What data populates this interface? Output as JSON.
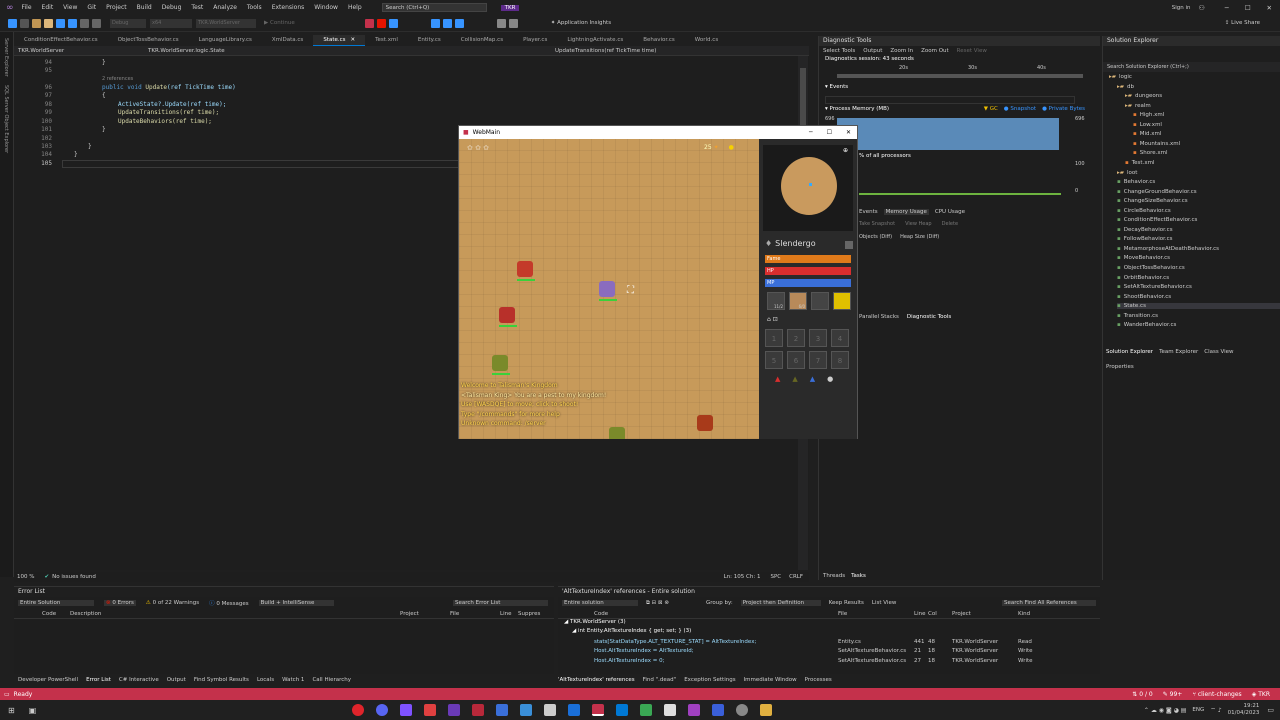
{
  "menu": {
    "items": [
      "File",
      "Edit",
      "View",
      "Git",
      "Project",
      "Build",
      "Debug",
      "Test",
      "Analyze",
      "Tools",
      "Extensions",
      "Window",
      "Help"
    ],
    "search": "Search (Ctrl+Q)",
    "app_badge": "TKR",
    "sign_in": "Sign in",
    "live_share": "Live Share"
  },
  "toolbar": {
    "config": "Debug",
    "platform": "x64",
    "target": "TKR.WorldServer",
    "continue": "Continue",
    "insights": "Application Insights"
  },
  "left_strip": [
    "Server Explorer",
    "SQL Server Object Explorer"
  ],
  "tabs": [
    "ConditionEffectBehavior.cs",
    "ObjectTossBehavior.cs",
    "LanguageLibrary.cs",
    "XmlData.cs",
    "State.cs",
    "Test.xml",
    "Entity.cs",
    "CollisionMap.cs",
    "Player.cs",
    "LightningActivate.cs",
    "Behavior.cs",
    "World.cs"
  ],
  "active_tab": "State.cs",
  "navbar": {
    "project": "TKR.WorldServer",
    "class": "TKR.WorldServer.logic.State",
    "member": "UpdateTransitions(ref TickTime time)"
  },
  "editor": {
    "line_numbers": [
      "94",
      "",
      "95",
      "96",
      "97",
      "98",
      "99",
      "100",
      "101",
      "102",
      "103",
      "104",
      "105"
    ],
    "refs": "2 references",
    "lines": {
      "l94": "}",
      "l96_kw": "public void ",
      "l96_fn": "Update",
      "l96_rest": "(ref TickTime time)",
      "l97": "{",
      "l98": "ActiveState?.Update(ref time);",
      "l99": "UpdateTransitions(ref time);",
      "l100": "UpdateBehaviors(ref time);",
      "l101": "}",
      "l102": "}",
      "l103": "}"
    }
  },
  "editor_status": {
    "zoom": "100 %",
    "issues": "No issues found",
    "position": "Ln: 105   Ch: 1",
    "spc": "SPC",
    "crlf": "CRLF"
  },
  "game": {
    "title": "WebMain",
    "player_name": "Slendergo",
    "fame_label": "Fame",
    "hp_label": "HP",
    "mp_label": "MP",
    "slot_counts": [
      "11/2",
      "6/0"
    ],
    "quickslot_nums": [
      "1",
      "2",
      "3",
      "4",
      "5",
      "6",
      "7",
      "8"
    ],
    "chat": [
      {
        "text": "Welcome to Talisman's Kingdom",
        "color": "#ffd34d"
      },
      {
        "text": "<Talisman King> You are a pest to my kingdom!",
        "color": "#ffe9a0"
      },
      {
        "text": "Use [WASDQE] to move; click to shoot!",
        "color": "#ffd34d"
      },
      {
        "text": "Type \"/commands\" for more help",
        "color": "#ffd34d"
      },
      {
        "text": "Unknown command: /server",
        "color": "#ffd34d"
      }
    ],
    "top_counter": "25"
  },
  "diagnostics": {
    "title": "Diagnostic Tools",
    "select_tools": "Select Tools",
    "output": "Output",
    "zoom_in": "Zoom In",
    "zoom_out": "Zoom Out",
    "reset_view": "Reset View",
    "session": "Diagnostics session: 43 seconds",
    "ticks": [
      "20s",
      "30s",
      "40s"
    ],
    "events": "Events",
    "process_memory": "Process Memory (MB)",
    "gc": "GC",
    "snapshot": "Snapshot",
    "private_bytes": "Private Bytes",
    "mem_max": "696",
    "mem_right": "696",
    "cpu_title": "% of all processors",
    "cpu_max": "100",
    "cpu_min": "0",
    "tabs": [
      "Summary",
      "Events",
      "Memory Usage",
      "CPU Usage"
    ],
    "take_snapshot": "Take Snapshot",
    "view_heap": "View Heap",
    "delete": "Delete",
    "objects_diff": "Objects (Diff)",
    "heap_diff": "Heap Size (Diff)",
    "bottom_tabs": [
      "Parallel Stacks",
      "Diagnostic Tools"
    ],
    "threads_tabs": [
      "Threads",
      "Tasks"
    ]
  },
  "solution": {
    "title": "Solution Explorer",
    "search": "Search Solution Explorer (Ctrl+;)",
    "items": [
      {
        "t": "logic",
        "d": 0
      },
      {
        "t": "db",
        "d": 1
      },
      {
        "t": "dungeons",
        "d": 2
      },
      {
        "t": "realm",
        "d": 2
      },
      {
        "t": "High.xml",
        "d": 3
      },
      {
        "t": "Low.xml",
        "d": 3
      },
      {
        "t": "Mid.xml",
        "d": 3
      },
      {
        "t": "Mountains.xml",
        "d": 3
      },
      {
        "t": "Shore.xml",
        "d": 3
      },
      {
        "t": "Test.xml",
        "d": 2
      },
      {
        "t": "loot",
        "d": 1
      },
      {
        "t": "Behavior.cs",
        "d": 1
      },
      {
        "t": "ChangeGroundBehavior.cs",
        "d": 1
      },
      {
        "t": "ChangeSizeBehavior.cs",
        "d": 1
      },
      {
        "t": "CircleBehavior.cs",
        "d": 1
      },
      {
        "t": "ConditionEffectBehavior.cs",
        "d": 1
      },
      {
        "t": "DecayBehavior.cs",
        "d": 1
      },
      {
        "t": "FollowBehavior.cs",
        "d": 1
      },
      {
        "t": "MetamorphoseAtDeathBehavior.cs",
        "d": 1
      },
      {
        "t": "MoveBehavior.cs",
        "d": 1
      },
      {
        "t": "ObjectTossBehavior.cs",
        "d": 1
      },
      {
        "t": "OrbitBehavior.cs",
        "d": 1
      },
      {
        "t": "SetAltTextureBehavior.cs",
        "d": 1
      },
      {
        "t": "ShootBehavior.cs",
        "d": 1
      },
      {
        "t": "State.cs",
        "d": 1
      },
      {
        "t": "Transition.cs",
        "d": 1
      },
      {
        "t": "WanderBehavior.cs",
        "d": 1
      }
    ],
    "bottom_tabs": [
      "Solution Explorer",
      "Team Explorer",
      "Class View"
    ],
    "properties": "Properties"
  },
  "error_list": {
    "title": "Error List",
    "scope": "Entire Solution",
    "errors": "0 Errors",
    "warnings": "0 of 22 Warnings",
    "messages": "0 Messages",
    "build": "Build + IntelliSense",
    "search": "Search Error List",
    "columns": [
      "Code",
      "Description",
      "Project",
      "File",
      "Line",
      "Suppres"
    ]
  },
  "references": {
    "title": "'AltTextureIndex' references - Entire solution",
    "scope": "Entire solution",
    "group_by_label": "Group by:",
    "group_by": "Project then Definition",
    "keep_results": "Keep Results",
    "list_view": "List View",
    "search": "Search Find All References",
    "columns": [
      "Code",
      "File",
      "Line",
      "Col",
      "Project",
      "Kind"
    ],
    "header": "TKR.WorldServer (3)",
    "subheader": "int Entity.AltTextureIndex { get; set; } (3)",
    "rows": [
      {
        "code": "stats[StatDataType.ALT_TEXTURE_STAT] = AltTextureIndex;",
        "file": "Entity.cs",
        "line": "441",
        "col": "48",
        "project": "TKR.WorldServer",
        "kind": "Read"
      },
      {
        "code": "Host.AltTextureIndex = AltTextureId;",
        "file": "SetAltTextureBehavior.cs",
        "line": "21",
        "col": "18",
        "project": "TKR.WorldServer",
        "kind": "Write"
      },
      {
        "code": "Host.AltTextureIndex = 0;",
        "file": "SetAltTextureBehavior.cs",
        "line": "27",
        "col": "18",
        "project": "TKR.WorldServer",
        "kind": "Write"
      }
    ]
  },
  "bottom_tabs": [
    "Developer PowerShell",
    "Error List",
    "C# Interactive",
    "Output",
    "Find Symbol Results",
    "Locals",
    "Watch 1",
    "Call Hierarchy"
  ],
  "bottom_tabs_right": [
    "'AltTextureIndex' references",
    "Find \".dead\"",
    "Exception Settings",
    "Immediate Window",
    "Processes"
  ],
  "status": {
    "ready": "Ready",
    "changes": "0 / 0",
    "commits": "99+",
    "branch": "client-changes",
    "repo": "TKR"
  },
  "taskbar": {
    "lang": "ENG",
    "time": "19:21",
    "date": "01/04/2023"
  },
  "colors": {
    "accent": "#0078d4",
    "status": "#c4314b",
    "fame": "#e07a1a",
    "hp": "#d92e2e",
    "mp": "#3a6fd9"
  }
}
